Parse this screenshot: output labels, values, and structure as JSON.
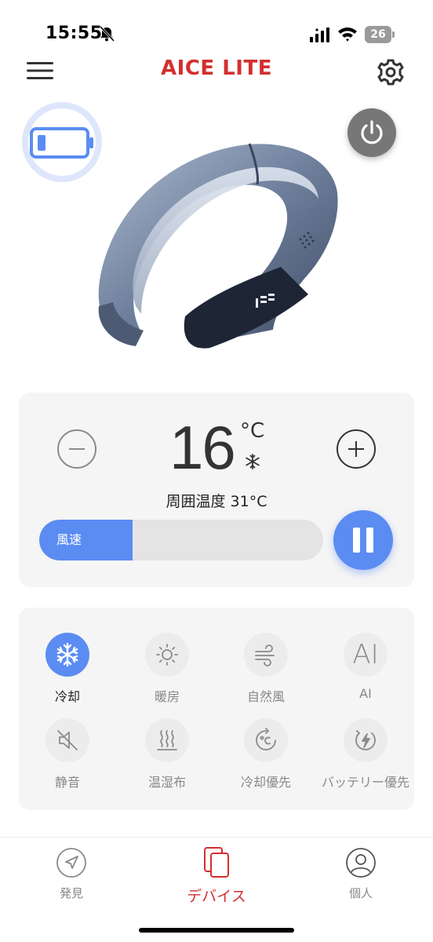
{
  "status_bar": {
    "time": "15:55",
    "battery_level": "26"
  },
  "header": {
    "title": "AICE LITE"
  },
  "hero": {
    "battery_icon": "battery-low-icon",
    "power_icon": "power-icon"
  },
  "control": {
    "temperature": "16",
    "temperature_unit": "°C",
    "mode_icon": "snowflake-icon",
    "ambient_label": "周囲温度  31°C",
    "fan_speed_label": "風速",
    "fan_speed_level": 0.33
  },
  "modes": [
    {
      "label": "冷却",
      "icon": "snowflake-icon",
      "active": true
    },
    {
      "label": "暖房",
      "icon": "sun-icon",
      "active": false
    },
    {
      "label": "自然風",
      "icon": "wind-icon",
      "active": false
    },
    {
      "label": "AI",
      "icon": "ai-icon",
      "active": false
    },
    {
      "label": "静音",
      "icon": "mute-speaker-icon",
      "active": false
    },
    {
      "label": "温湿布",
      "icon": "heat-waves-icon",
      "active": false
    },
    {
      "label": "冷却優先",
      "icon": "celsius-icon",
      "active": false
    },
    {
      "label": "バッテリー優先",
      "icon": "battery-charge-icon",
      "active": false
    }
  ],
  "tabs": [
    {
      "label": "発見",
      "icon": "navigation-arrow-icon",
      "active": false
    },
    {
      "label": "デバイス",
      "icon": "devices-icon",
      "active": true
    },
    {
      "label": "個人",
      "icon": "user-icon",
      "active": false
    }
  ],
  "colors": {
    "brand": "#d32f2f",
    "accent": "#5b8cf2",
    "card_bg": "#f5f5f5"
  }
}
